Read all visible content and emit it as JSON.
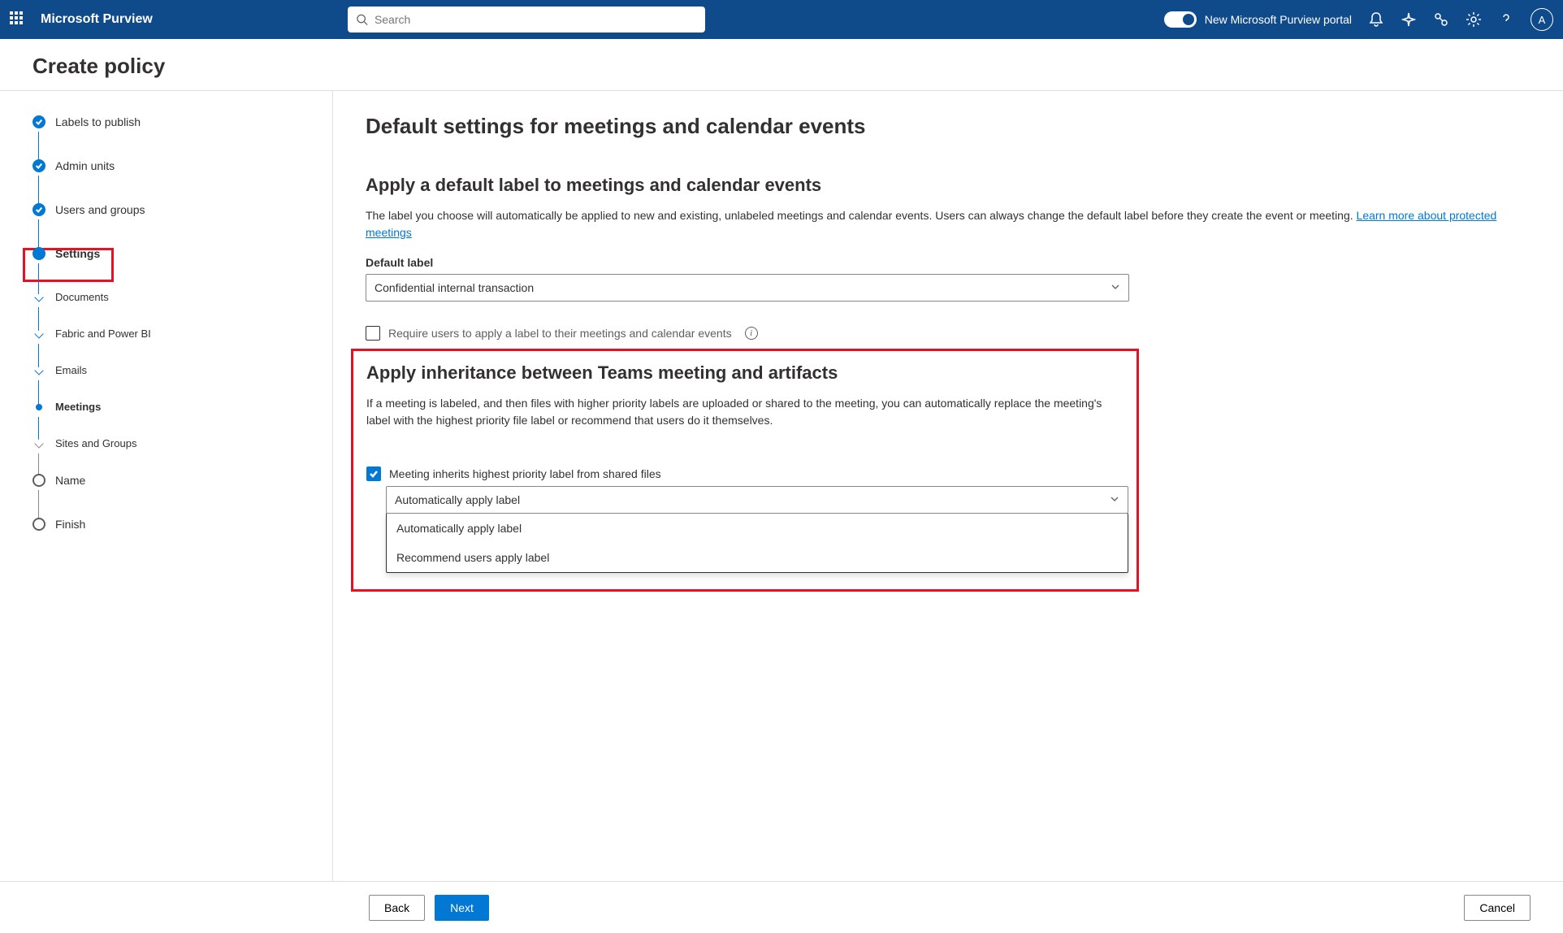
{
  "header": {
    "brand": "Microsoft Purview",
    "search_placeholder": "Search",
    "toggle_label": "New Microsoft Purview portal",
    "avatar_initial": "A"
  },
  "page_title": "Create policy",
  "steps": [
    {
      "label": "Labels to publish",
      "state": "done"
    },
    {
      "label": "Admin units",
      "state": "done"
    },
    {
      "label": "Users and groups",
      "state": "done"
    },
    {
      "label": "Settings",
      "state": "current"
    },
    {
      "label": "Documents",
      "state": "sub"
    },
    {
      "label": "Fabric and Power BI",
      "state": "sub"
    },
    {
      "label": "Emails",
      "state": "sub"
    },
    {
      "label": "Meetings",
      "state": "sub-current"
    },
    {
      "label": "Sites and Groups",
      "state": "sub-future"
    },
    {
      "label": "Name",
      "state": "future"
    },
    {
      "label": "Finish",
      "state": "future"
    }
  ],
  "main": {
    "heading": "Default settings for meetings and calendar events",
    "section1_heading": "Apply a default label to meetings and calendar events",
    "section1_desc": "The label you choose will automatically be applied to new and existing, unlabeled meetings and calendar events. Users can always change the default label before they create the event or meeting. ",
    "section1_link": "Learn more about protected meetings",
    "default_label_label": "Default label",
    "default_label_value": "Confidential internal transaction",
    "require_label_cb": "Require users to apply a label to their meetings and calendar events",
    "section2_heading": "Apply inheritance between Teams meeting and artifacts",
    "section2_desc": "If a meeting is labeled, and then files with higher priority labels are uploaded or shared to the meeting, you can automatically replace the meeting's label with the highest priority file label or recommend that users do it themselves.",
    "inherit_cb": "Meeting inherits highest priority label from shared files",
    "inherit_select_value": "Automatically apply label",
    "inherit_options": [
      "Automatically apply label",
      "Recommend users apply label"
    ]
  },
  "footer": {
    "back": "Back",
    "next": "Next",
    "cancel": "Cancel"
  }
}
